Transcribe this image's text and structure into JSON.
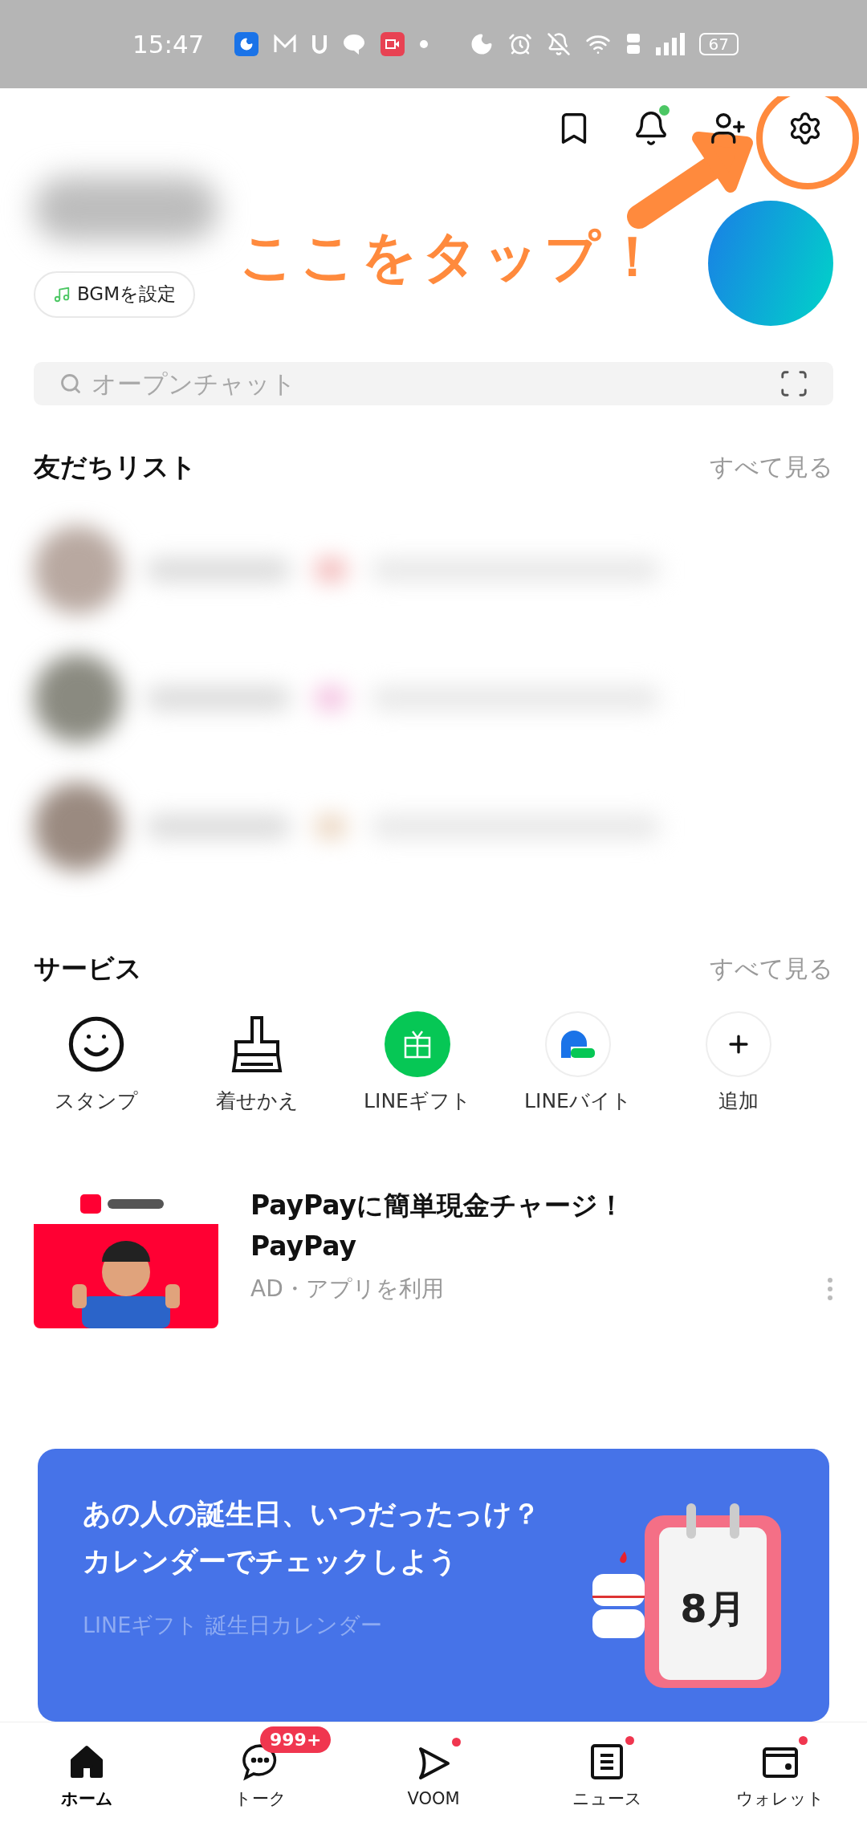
{
  "status_bar": {
    "time": "15:47",
    "battery": "67"
  },
  "annotation": {
    "text": "ここをタップ！"
  },
  "header": {
    "notification_dot": true
  },
  "profile": {
    "bgm_button": "BGMを設定"
  },
  "search": {
    "placeholder": "オープンチャット"
  },
  "friends": {
    "title": "友だちリスト",
    "see_all": "すべて見る"
  },
  "services": {
    "title": "サービス",
    "see_all": "すべて見る",
    "items": [
      {
        "kind": "sticker",
        "label": "スタンプ"
      },
      {
        "kind": "theme",
        "label": "着せかえ"
      },
      {
        "kind": "gift",
        "label": "LINEギフト"
      },
      {
        "kind": "job",
        "label": "LINEバイト"
      },
      {
        "kind": "add",
        "label": "追加"
      }
    ]
  },
  "ad": {
    "kind": "picture",
    "headline": "PayPayに簡単現金チャージ！",
    "advertiser": "PayPay",
    "meta": "AD・アプリを利用"
  },
  "banner": {
    "line1": "あの人の誕生日、いつだったっけ？",
    "line2": "カレンダーでチェックしよう",
    "caption": "LINEギフト 誕生日カレンダー",
    "calendar_month": "8月"
  },
  "nav": [
    {
      "kind": "home",
      "label": "ホーム",
      "selected": true
    },
    {
      "kind": "talk",
      "label": "トーク",
      "selected": false,
      "badge": "999+"
    },
    {
      "kind": "voom",
      "label": "VOOM",
      "selected": false,
      "dot": true
    },
    {
      "kind": "news",
      "label": "ニュース",
      "selected": false,
      "dot": true
    },
    {
      "kind": "wallet",
      "label": "ウォレット",
      "selected": false,
      "dot": true
    }
  ]
}
